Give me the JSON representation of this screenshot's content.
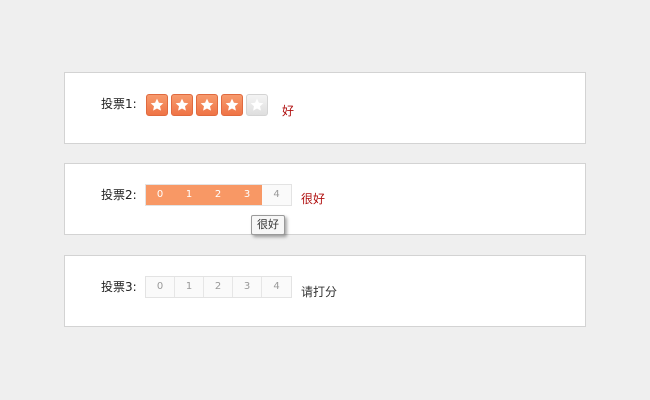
{
  "vote1": {
    "label": "投票1:",
    "rating": 4,
    "max": 5,
    "status": "好",
    "star_on_color": "#f07a4c",
    "star_off_color": "#e0e0e0"
  },
  "vote2": {
    "label": "投票2:",
    "numbers": [
      "0",
      "1",
      "2",
      "3",
      "4"
    ],
    "selected_through": 3,
    "status": "很好",
    "tooltip": "很好",
    "highlight_color": "#f89865"
  },
  "vote3": {
    "label": "投票3:",
    "numbers": [
      "0",
      "1",
      "2",
      "3",
      "4"
    ],
    "selected_through": -1,
    "status": "请打分"
  }
}
